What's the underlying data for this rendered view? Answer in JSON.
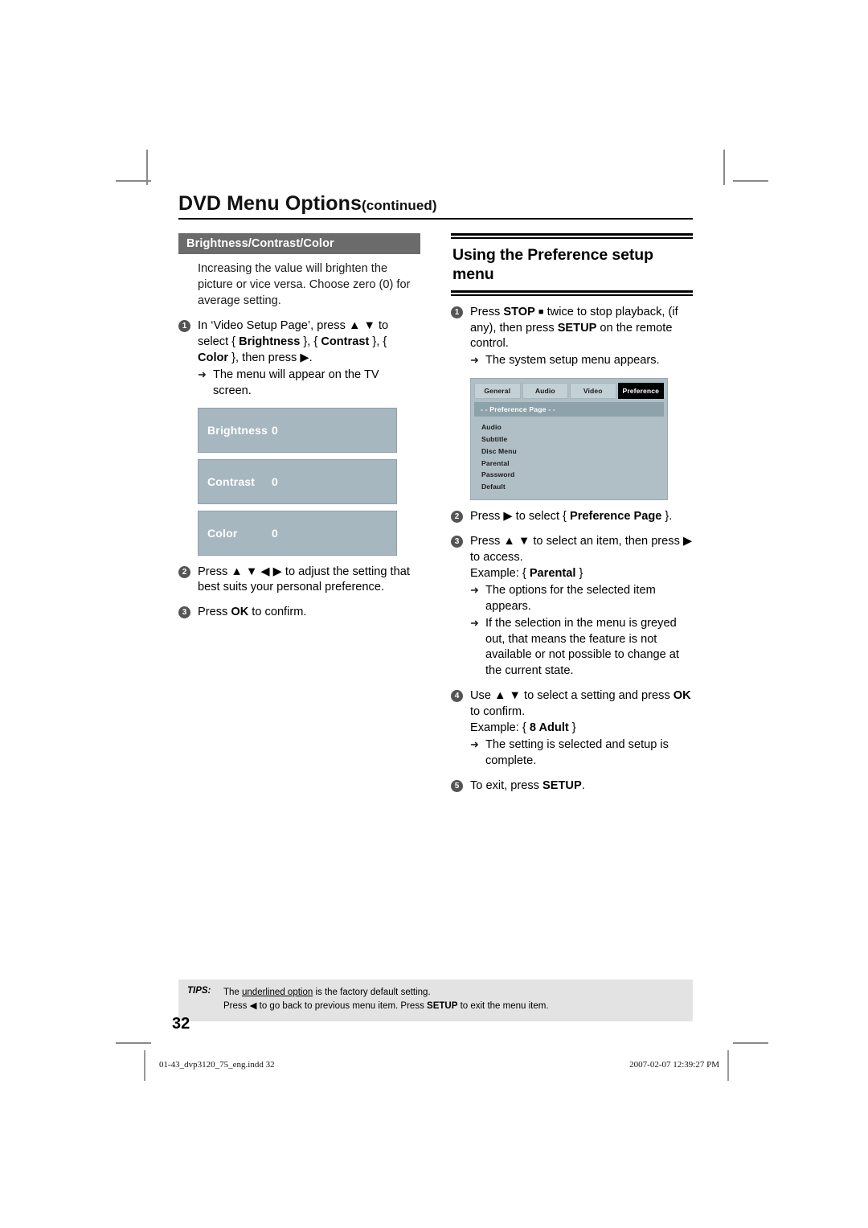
{
  "header": {
    "chapter_title": "DVD Menu Options",
    "continued": "(continued)"
  },
  "left_column": {
    "section_bar": "Brightness/Contrast/Color",
    "intro_line1": "Increasing the value will brighten the",
    "intro_line2": "picture or vice versa. Choose zero (0)",
    "intro_line3": "for average setting.",
    "steps": [
      {
        "num": "1",
        "line1_a": "In ‘Video Setup Page’, press ",
        "line1_arrows": "▲ ▼",
        "line1_b": " to",
        "line2_a": "select { ",
        "line2_b": "Brightness",
        "line2_c": " }, { ",
        "line2_d": "Contrast",
        "line2_e": " },",
        "line3_a": "{ ",
        "line3_b": "Color",
        "line3_c": " }, then press ",
        "line3_d": "▶",
        "line3_e": ".",
        "sub": "The menu will appear on the TV screen."
      },
      {
        "num": "2",
        "text_a": "Press ",
        "text_arrows": "▲ ▼ ◀ ▶",
        "text_b": " to adjust the setting that best suits your personal preference."
      },
      {
        "num": "3",
        "text_a": "Press ",
        "text_bold": "OK",
        "text_b": " to confirm."
      }
    ],
    "value_boxes": [
      {
        "label": "Brightness",
        "value": "0"
      },
      {
        "label": "Contrast",
        "value": "0"
      },
      {
        "label": "Color",
        "value": "0"
      }
    ]
  },
  "right_column": {
    "section_heading_line1": "Using the Preference setup",
    "section_heading_line2": "menu",
    "steps": [
      {
        "num": "1",
        "a": "Press ",
        "stop_bold": "STOP",
        "stop_icon": "■",
        "b": " twice to stop playback, (if any), then press ",
        "setup_bold": "SETUP",
        "c": " on the remote control.",
        "sub": "The system setup menu appears."
      },
      {
        "num": "2",
        "a": "Press ",
        "arrow": "▶",
        "b": " to select { ",
        "bold": "Preference Page",
        "c": " }."
      },
      {
        "num": "3",
        "a": "Press ",
        "arrows": "▲ ▼",
        "b": " to select an item, then press ",
        "arrow2": "▶",
        "c": " to access.",
        "example_label": "Example: { ",
        "example_bold": "Parental",
        "example_close": " }",
        "sub1": "The options for the selected item appears.",
        "sub2": "If the selection in the menu is greyed out, that means the feature is not available or not possible to change at the current state."
      },
      {
        "num": "4",
        "a": "Use ",
        "arrows": "▲ ▼",
        "b": " to select a setting and press ",
        "ok_bold": "OK",
        "c": " to confirm.",
        "example_label": "Example: { ",
        "example_bold": "8 Adult",
        "example_close": " }",
        "sub": "The setting is selected and setup is complete."
      },
      {
        "num": "5",
        "a": "To exit, press ",
        "setup_bold": "SETUP",
        "b": "."
      }
    ],
    "tv_menu": {
      "tabs": [
        {
          "label": "General",
          "active": false
        },
        {
          "label": "Audio",
          "active": false
        },
        {
          "label": "Video",
          "active": false
        },
        {
          "label": "Preference",
          "active": true
        }
      ],
      "page_bar": "- -  Preference Page  - -",
      "items": [
        "Audio",
        "Subtitle",
        "Disc Menu",
        "Parental",
        "Password",
        "Default"
      ],
      "colors": {
        "screen_bg": "#b0bfc6",
        "tab_bg": "#c3d0d6",
        "tab_active_bg": "#000000",
        "page_bar_bg": "#8ea2ac"
      }
    }
  },
  "tips": {
    "label": "TIPS:",
    "line1_a": "The ",
    "line1_underlined": "underlined option",
    "line1_b": " is the factory default setting.",
    "line2_a": "Press ",
    "line2_arrow": "◀",
    "line2_b": " to go back to previous menu item. Press ",
    "line2_bold": "SETUP",
    "line2_c": " to exit the menu item."
  },
  "page_number": "32",
  "print_footer": {
    "file": "01-43_dvp3120_75_eng.indd   32",
    "timestamp": "2007-02-07   12:39:27 PM"
  },
  "colors": {
    "section_bar": "#6b6b6b",
    "value_box": "#a6b7bf",
    "bullet": "#545454",
    "tips_bg": "#e3e3e3"
  }
}
